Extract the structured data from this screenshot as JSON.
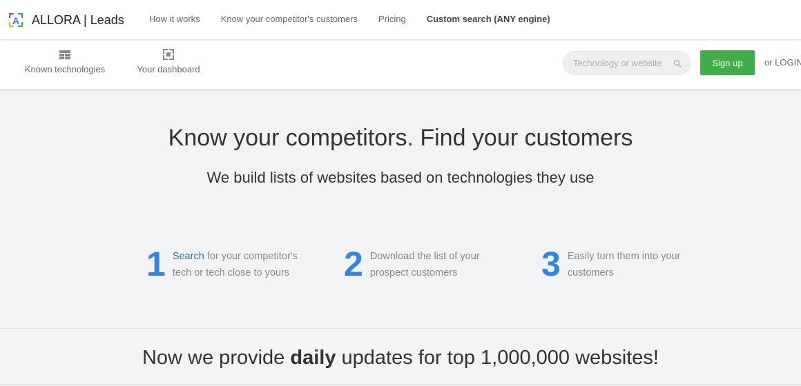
{
  "brand": {
    "name": "ALLORA | Leads",
    "logo_letter": "A",
    "colors": [
      "#e23b2e",
      "#2f84e4",
      "#f6b91f",
      "#3fae49"
    ]
  },
  "topnav": {
    "links": [
      {
        "label": "How it works",
        "bold": false
      },
      {
        "label": "Know your competitor's customers",
        "bold": false
      },
      {
        "label": "Pricing",
        "bold": false
      },
      {
        "label": "Custom search (ANY engine)",
        "bold": true
      }
    ]
  },
  "subbar": {
    "known_technologies": {
      "label": "Known technologies",
      "icon": "table-icon"
    },
    "dashboard": {
      "label": "Your dashboard",
      "icon": "dashboard-icon"
    },
    "search": {
      "placeholder": "Technology or website",
      "icon": "search-icon"
    },
    "signup_label": "Sign up",
    "login_label": "or LOGIN"
  },
  "hero": {
    "title": "Know your competitors. Find your customers",
    "subtitle": "We build lists of websites based on technologies they use"
  },
  "steps": [
    {
      "number": "1",
      "link": "Search",
      "line1_rest": " for your competitor's",
      "line2": "tech or tech close to yours"
    },
    {
      "number": "2",
      "line1": "Download the list of your",
      "line2": "prospect customers"
    },
    {
      "number": "3",
      "line1": "Easily turn them into your",
      "line2": "customers"
    }
  ],
  "updates": {
    "before": "Now we provide ",
    "bold": "daily",
    "after": " updates for top 1,000,000 websites!"
  },
  "accent_color": "#2f84e4",
  "signup_color": "#3fae49"
}
